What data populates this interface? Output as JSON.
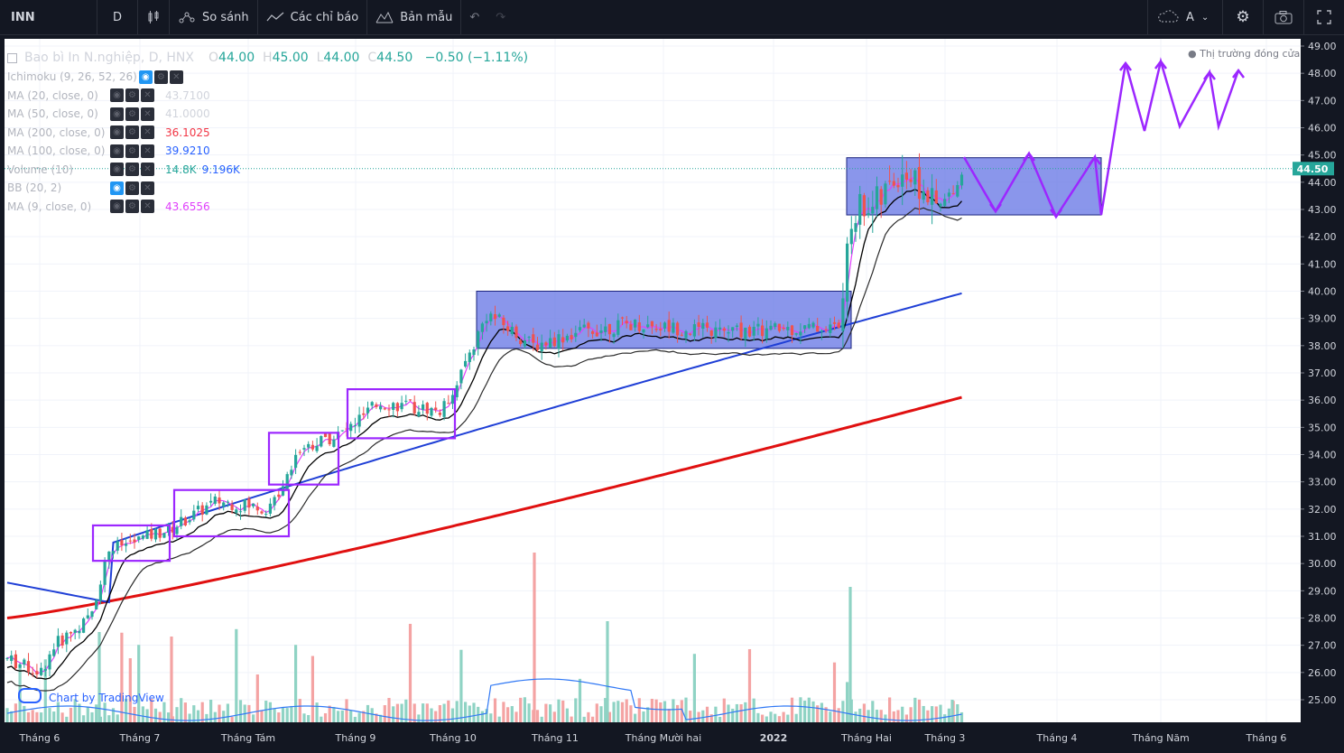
{
  "toolbar": {
    "symbol": "INN",
    "interval": "D",
    "compare_label": "So sánh",
    "indicators_label": "Các chỉ báo",
    "templates_label": "Bản mẫu",
    "auto_label": "A"
  },
  "legend": {
    "title": "Bao bì In N.nghiệp, D, HNX",
    "open_key": "O",
    "open": "44.00",
    "high_key": "H",
    "high": "45.00",
    "low_key": "L",
    "low": "44.00",
    "close_key": "C",
    "close": "44.50",
    "change": "−0.50 (−1.11%)",
    "indicators": [
      {
        "name": "Ichimoku (9, 26, 52, 26)",
        "value": "",
        "value2": "",
        "color": "#b2b5be"
      },
      {
        "name": "MA (20, close, 0)",
        "value": "43.7100",
        "value2": "",
        "color": "#d1d4dc"
      },
      {
        "name": "MA (50, close, 0)",
        "value": "41.0000",
        "value2": "",
        "color": "#d1d4dc"
      },
      {
        "name": "MA (200, close, 0)",
        "value": "36.1025",
        "value2": "",
        "color": "#f23645"
      },
      {
        "name": "MA (100, close, 0)",
        "value": "39.9210",
        "value2": "",
        "color": "#2962ff"
      },
      {
        "name": "Volume (10)",
        "value": "14.8K",
        "value2": "9.196K",
        "color": "#26a69a"
      },
      {
        "name": "BB (20, 2)",
        "value": "",
        "value2": "",
        "color": "#b2b5be"
      },
      {
        "name": "MA (9, close, 0)",
        "value": "43.6556",
        "value2": "",
        "color": "#e040fb"
      }
    ]
  },
  "market_status": "● Thị trường đóng cửa",
  "watermark": "Chart by TradingView",
  "colors": {
    "up": "#26a69a",
    "down": "#ef5350",
    "ma20": "#000000",
    "ma50": "#2b2b2b",
    "ma100": "#1f3fd6",
    "ma200": "#e01010",
    "ma9": "#e040fb",
    "volma": "#3179f5",
    "annotation": "#9c27ff",
    "zone": "#6d7ce6"
  },
  "chart_data": {
    "type": "candlestick",
    "x_labels": [
      "Tháng 6",
      "Tháng 7",
      "Tháng Tám",
      "Tháng 9",
      "Tháng 10",
      "Tháng 11",
      "Tháng Mười hai",
      "2022",
      "Tháng Hai",
      "Tháng 3",
      "Tháng 4",
      "Tháng Năm",
      "Tháng 6"
    ],
    "y_ticks": [
      "25.00",
      "26.00",
      "27.00",
      "28.00",
      "29.00",
      "30.00",
      "31.00",
      "32.00",
      "33.00",
      "34.00",
      "35.00",
      "36.00",
      "37.00",
      "38.00",
      "39.00",
      "40.00",
      "41.00",
      "42.00",
      "43.00",
      "44.00",
      "45.00",
      "46.00",
      "47.00",
      "48.00",
      "49.00"
    ],
    "ylim": [
      24.3,
      49.3
    ],
    "last_price": 44.5,
    "last_price_label": "44.50",
    "moving_averages": {
      "ma20_end": 43.71,
      "ma50_end": 41.0,
      "ma100_end": 39.921,
      "ma200_end": 36.1025,
      "ma9_end": 43.6556
    },
    "consolidation_zones": [
      {
        "from": "Tháng 10",
        "to": "2022",
        "low": 37.9,
        "high": 40.0
      },
      {
        "from": "Tháng Hai",
        "to": "Tháng 4",
        "low": 42.8,
        "high": 44.9
      }
    ],
    "volume_last": "14.8K",
    "volume_ma": "9.196K"
  }
}
